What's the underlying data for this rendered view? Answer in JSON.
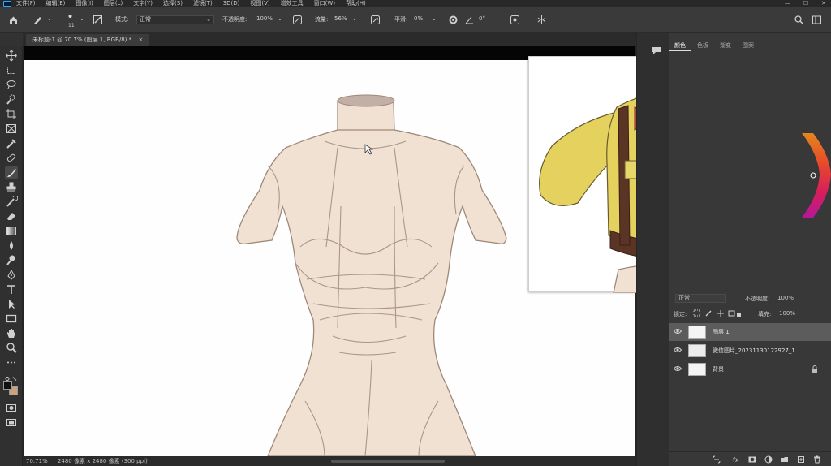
{
  "menu": {
    "items": [
      "文件(F)",
      "编辑(E)",
      "图像(I)",
      "图层(L)",
      "文字(Y)",
      "选择(S)",
      "滤镜(T)",
      "3D(D)",
      "视图(V)",
      "增效工具",
      "窗口(W)",
      "帮助(H)"
    ],
    "window_controls": [
      "—",
      "☐",
      "✕"
    ]
  },
  "options_bar": {
    "brush_size": "11",
    "mode_label": "模式:",
    "mode_value": "正常",
    "opacity_label": "不透明度:",
    "opacity_value": "100%",
    "flow_label": "流量:",
    "flow_value": "56%",
    "smoothing_label": "平滑:",
    "smoothing_value": "0%",
    "angle_value": "0°"
  },
  "document_tab": {
    "title": "未标题-1 @ 70.7% (图层 1, RGB/8) *",
    "close": "×"
  },
  "status_bar": {
    "zoom": "70.71%",
    "info": "2480 像素 x 2480 像素 (300 ppi)"
  },
  "panels": {
    "tabs": [
      "颜色",
      "色板",
      "渐变",
      "图案"
    ],
    "active_tab_index": 0
  },
  "layers_panel": {
    "blend_mode": "正常",
    "opacity_label": "不透明度:",
    "opacity_value": "100%",
    "lock_label": "锁定:",
    "fill_label": "填充:",
    "fill_value": "100%",
    "layers": [
      {
        "name": "图层 1",
        "selected": true,
        "visible": true,
        "locked": false
      },
      {
        "name": "微信图片_20231130122927_1",
        "selected": false,
        "visible": true,
        "locked": false
      },
      {
        "name": "背景",
        "selected": false,
        "visible": true,
        "locked": true
      }
    ]
  },
  "colors": {
    "foreground": "#111111",
    "background": "#c9a27e",
    "accent": "#31a8ff",
    "figure_skin": "#f0e1d2",
    "figure_line": "#9f8878",
    "shirt_yellow": "#e5d25e",
    "ribbon_red": "#b9473f",
    "strap_brown": "#5a3424"
  },
  "tools": [
    "move-tool",
    "artboard-tool",
    "marquee-tool",
    "lasso-tool",
    "quick-select-tool",
    "crop-tool",
    "frame-tool",
    "eyedropper-tool",
    "healing-tool",
    "brush-tool",
    "stamp-tool",
    "history-brush-tool",
    "eraser-tool",
    "gradient-tool",
    "blur-tool",
    "dodge-tool",
    "pen-tool",
    "type-tool",
    "path-select-tool",
    "rectangle-tool",
    "hand-tool",
    "zoom-tool",
    "more-tools"
  ]
}
